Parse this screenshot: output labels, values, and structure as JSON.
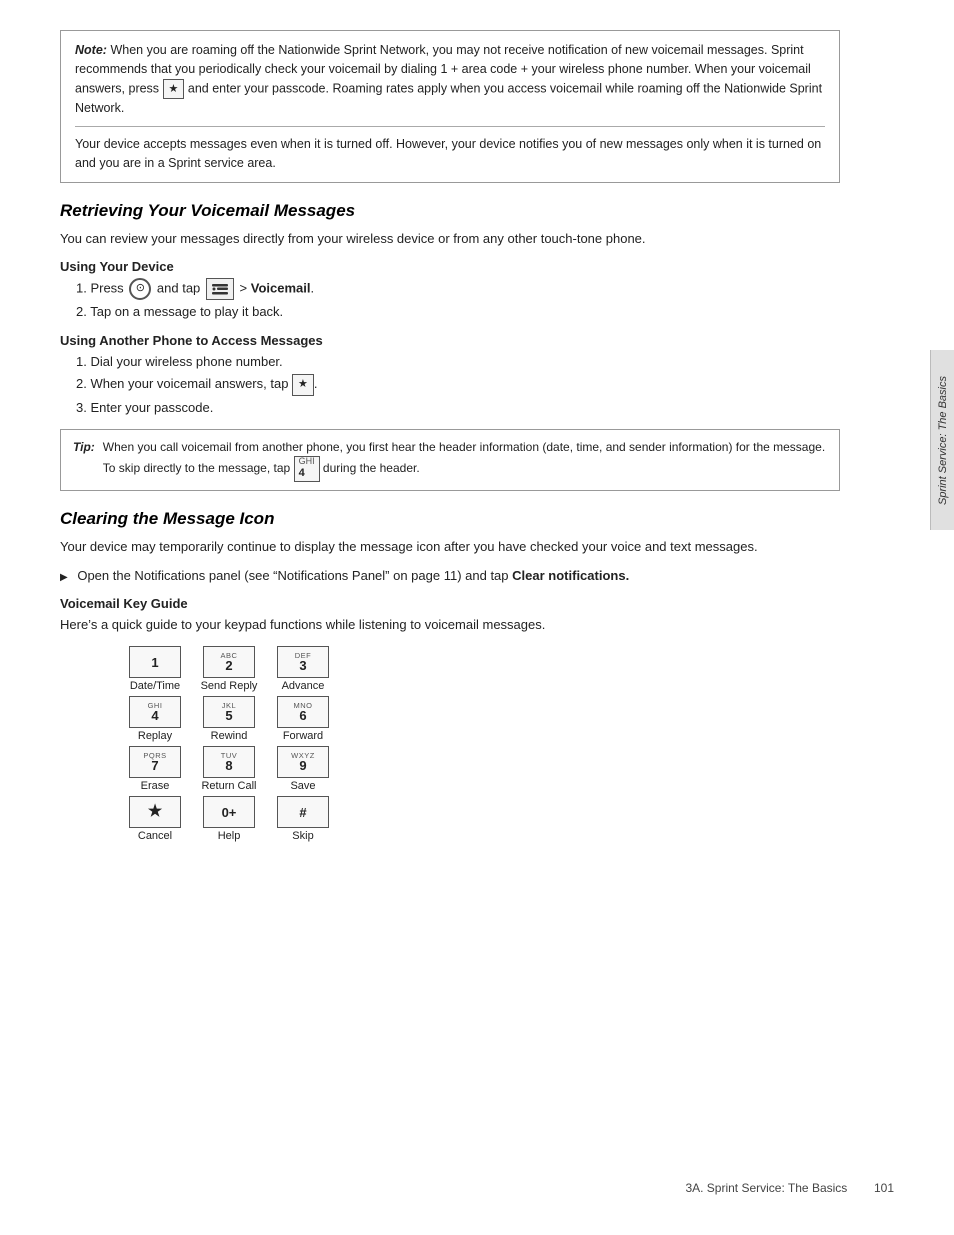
{
  "note": {
    "label": "Note:",
    "text1": "When you are roaming off the Nationwide Sprint Network, you may not receive notification of new voicemail messages. Sprint recommends that you periodically check your voicemail by dialing 1 + area code + your wireless phone number. When your voicemail answers, press",
    "key_star": "★",
    "text2": "and enter your passcode. Roaming rates apply when you access voicemail while roaming off the Nationwide Sprint Network.",
    "inner_text": "Your device accepts messages even when it is turned off. However, your device notifies you of new messages only when it is turned on and you are in a Sprint service area."
  },
  "section1": {
    "title": "Retrieving Your Voicemail Messages",
    "intro": "You can review your messages directly from your wireless device or from any other touch-tone phone.",
    "subsection1": {
      "title": "Using Your Device",
      "steps": [
        "Press   and tap   > Voicemail.",
        "Tap on a message to play it back."
      ]
    },
    "subsection2": {
      "title": "Using Another Phone to Access Messages",
      "steps": [
        "Dial your wireless phone number.",
        "When your voicemail answers, tap   ★   .",
        "Enter your passcode."
      ]
    },
    "tip": {
      "label": "Tip:",
      "text": "When you call voicemail from another phone, you first hear the header information (date, time, and sender information) for the message. To skip directly to the message, tap",
      "key": "4",
      "key_sub": "GHI",
      "text2": "during the header."
    }
  },
  "section2": {
    "title": "Clearing the Message Icon",
    "intro": "Your device may temporarily continue to display the message icon after you have checked your voice and text messages.",
    "bullet": "Open the Notifications panel (see “Notifications Panel” on page 11) and tap",
    "bullet_bold": "Clear notifications.",
    "subsection": {
      "title": "Voicemail Key Guide",
      "intro": "Here’s a quick guide to your keypad functions while listening to voicemail messages."
    }
  },
  "keypad": {
    "keys": [
      {
        "main": "1",
        "sub": "",
        "label": "Date/Time"
      },
      {
        "main": "2",
        "sub": "ABC",
        "label": "Send Reply"
      },
      {
        "main": "3",
        "sub": "DEF",
        "label": "Advance"
      },
      {
        "main": "4",
        "sub": "GHI",
        "label": "Replay"
      },
      {
        "main": "5",
        "sub": "JKL",
        "label": "Rewind"
      },
      {
        "main": "6",
        "sub": "MNO",
        "label": "Forward"
      },
      {
        "main": "7",
        "sub": "PQRS",
        "label": "Erase"
      },
      {
        "main": "8",
        "sub": "TUV",
        "label": "Return Call"
      },
      {
        "main": "9",
        "sub": "WXYZ",
        "label": "Save"
      },
      {
        "main": "★",
        "sub": "",
        "label": "Cancel"
      },
      {
        "main": "0+",
        "sub": "",
        "label": "Help"
      },
      {
        "main": "#",
        "sub": "",
        "label": "Skip"
      }
    ]
  },
  "side_tab": {
    "text": "Sprint Service: The Basics"
  },
  "footer": {
    "text": "3A. Sprint Service: The Basics",
    "page": "101"
  }
}
